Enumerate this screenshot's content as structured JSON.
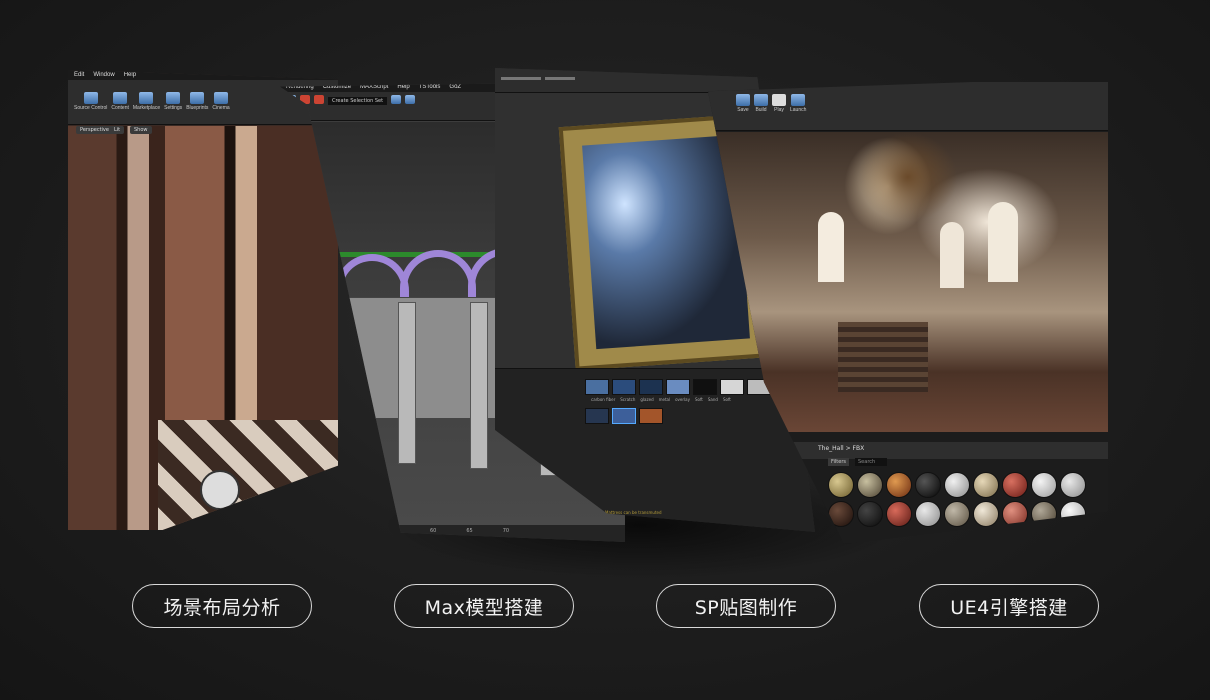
{
  "labels": [
    {
      "text": "场景布局分析"
    },
    {
      "text": "Max模型搭建"
    },
    {
      "text": "SP贴图制作"
    },
    {
      "text": "UE4引擎搭建"
    }
  ],
  "panel1": {
    "menu": [
      "Edit",
      "Window",
      "Help"
    ],
    "tools": [
      "Source Control",
      "Content",
      "Marketplace",
      "Settings",
      "Blueprints",
      "Cinema"
    ],
    "viewport_buttons": [
      "Perspective",
      "Lit",
      "Show"
    ]
  },
  "panel2": {
    "menu": [
      "Rendering",
      "Customize",
      "MAXScript",
      "Help",
      "TSTools",
      "GoZ"
    ],
    "selection": "Create Selection Set",
    "ruler": [
      "60",
      "65",
      "70"
    ]
  },
  "panel3": {
    "thumb_labels": [
      "carbon fiber",
      "Scratch",
      "glazed",
      "metal",
      "overlay",
      "Soft",
      "Sand",
      "Soft"
    ],
    "status": "Mattress can be transmuted"
  },
  "panel4": {
    "tools": [
      "Save",
      "Build",
      "Play",
      "Launch"
    ],
    "path": "The_Hall > FBX",
    "filter": "Filters",
    "search_placeholder": "Search"
  },
  "colors": {
    "background": "#1f1f1f",
    "label_border": "#d8d8d8",
    "arch_purple": "#9f86d8"
  }
}
